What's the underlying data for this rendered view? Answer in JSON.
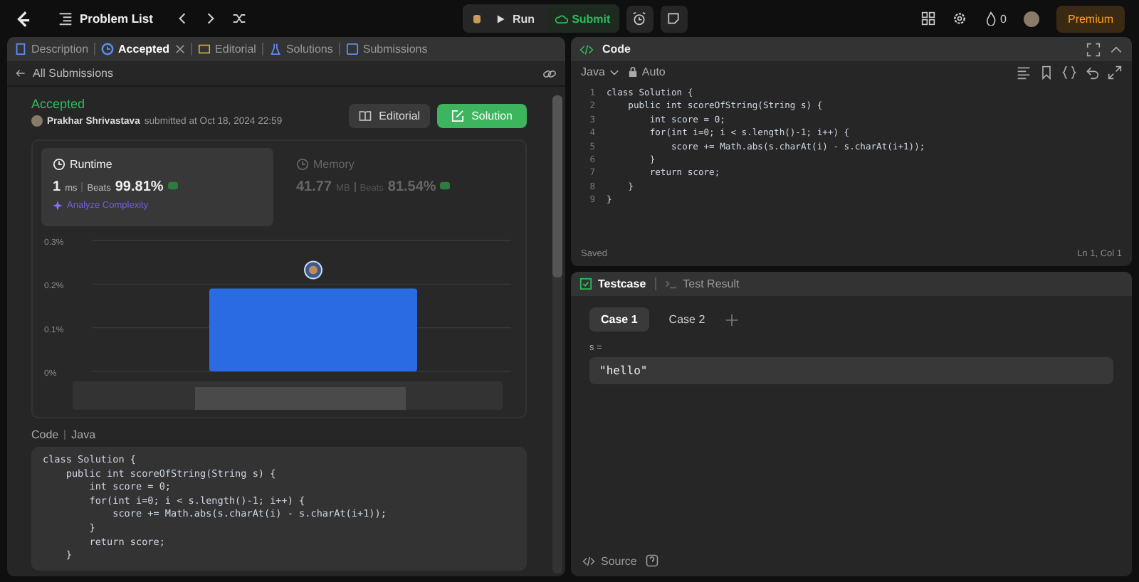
{
  "top_bar": {
    "title": "Problem List",
    "run": "Run",
    "submit": "Submit",
    "streak": "0",
    "premium": "Premium"
  },
  "left_tabs": [
    {
      "label": "Description",
      "selected": false,
      "closable": false
    },
    {
      "label": "Accepted",
      "selected": true,
      "closable": true
    },
    {
      "label": "Editorial",
      "selected": false,
      "closable": false
    },
    {
      "label": "Solutions",
      "selected": false,
      "closable": false
    },
    {
      "label": "Submissions",
      "selected": false,
      "closable": false
    }
  ],
  "back_link": "All Submissions",
  "submission": {
    "status": "Accepted",
    "author": "Prakhar Shrivastava",
    "submitted": "submitted at Oct 18, 2024 22:59",
    "editorial_button": "Editorial",
    "solution_button": "Solution"
  },
  "stats": [
    {
      "title": "Runtime",
      "value": "1",
      "unit": "ms",
      "beats_label": "Beats",
      "beats": "99.81%",
      "selected": true,
      "link": "Analyze Complexity"
    },
    {
      "title": "Memory",
      "value": "41.77",
      "unit": "MB",
      "beats_label": "Beats",
      "beats": "81.54%",
      "selected": false
    }
  ],
  "chart_data": {
    "type": "bar",
    "values": [
      0.19
    ],
    "ylim": [
      0,
      0.3
    ],
    "yticks": [
      {
        "value": 0,
        "label": "0%"
      },
      {
        "value": 0.1,
        "label": "0.1%"
      },
      {
        "value": 0.2,
        "label": "0.2%"
      },
      {
        "value": 0.3,
        "label": "0.3%"
      }
    ]
  },
  "code_section": {
    "label": "Code",
    "language": "Java",
    "lines": [
      "class Solution {",
      "    public int scoreOfString(String s) {",
      "        int score = 0;",
      "        for(int i=0; i < s.length()-1; i++) {",
      "            score += Math.abs(s.charAt(i) - s.charAt(i+1));",
      "        }",
      "        return score;",
      "    }"
    ]
  },
  "editor": {
    "title": "Code",
    "language": "Java",
    "mode": "Auto",
    "lines": [
      {
        "number": "1",
        "text": "class Solution {"
      },
      {
        "number": "2",
        "text": "    public int scoreOfString(String s) {"
      },
      {
        "number": "3",
        "text": "        int score = 0;"
      },
      {
        "number": "4",
        "text": "        for(int i=0; i < s.length()-1; i++) {"
      },
      {
        "number": "5",
        "text": "            score += Math.abs(s.charAt(i) - s.charAt(i+1));"
      },
      {
        "number": "6",
        "text": "        }"
      },
      {
        "number": "7",
        "text": "        return score;"
      },
      {
        "number": "8",
        "text": "    }"
      },
      {
        "number": "9",
        "text": "}"
      }
    ],
    "status": "Saved",
    "cursor": "Ln 1, Col 1"
  },
  "console": {
    "tabs": [
      {
        "label": "Testcase",
        "selected": true
      },
      {
        "label": "Test Result",
        "selected": false
      }
    ],
    "cases": [
      {
        "label": "Case 1",
        "selected": true
      },
      {
        "label": "Case 2",
        "selected": false
      }
    ],
    "params": [
      {
        "name": "s =",
        "value": "\"hello\""
      }
    ],
    "footer": "Source"
  }
}
